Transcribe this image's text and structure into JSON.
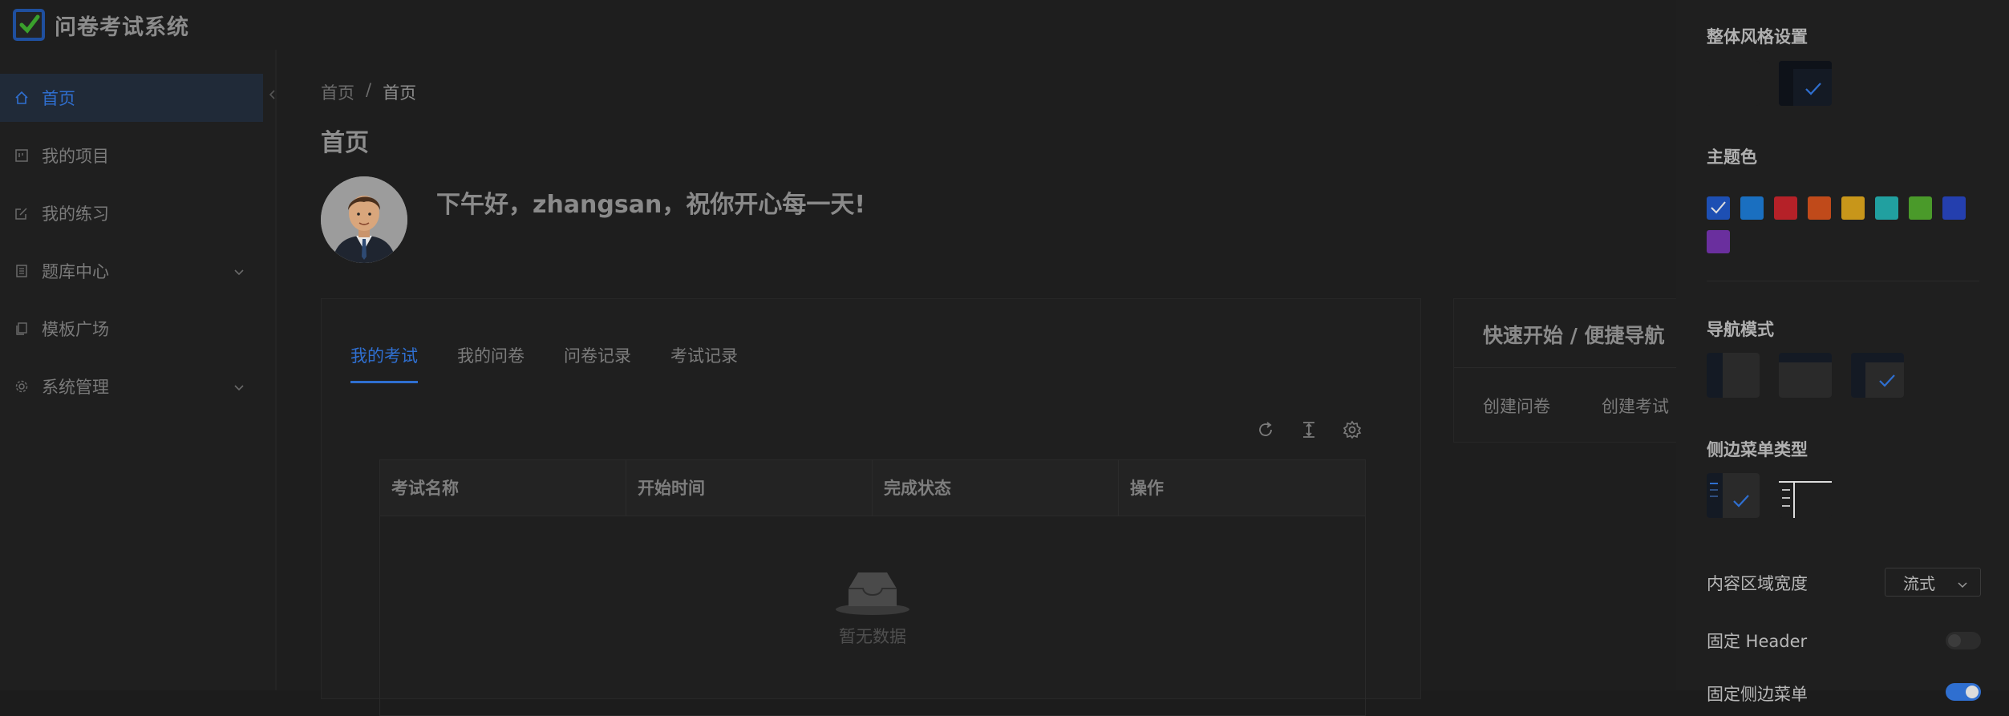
{
  "app": {
    "title": "问卷考试系统"
  },
  "sidebar": {
    "items": [
      {
        "label": "首页",
        "icon": "home-icon",
        "active": true
      },
      {
        "label": "我的项目",
        "icon": "project-icon"
      },
      {
        "label": "我的练习",
        "icon": "edit-icon"
      },
      {
        "label": "题库中心",
        "icon": "book-icon",
        "expandable": true
      },
      {
        "label": "模板广场",
        "icon": "template-icon"
      },
      {
        "label": "系统管理",
        "icon": "gear-icon",
        "expandable": true
      }
    ]
  },
  "breadcrumb": {
    "root": "首页",
    "separator": "/",
    "current": "首页"
  },
  "page": {
    "title": "首页",
    "greeting": "下午好，zhangsan，祝你开心每一天!"
  },
  "main_card": {
    "tabs": [
      "我的考试",
      "我的问卷",
      "问卷记录",
      "考试记录"
    ],
    "active_tab": "我的考试",
    "table": {
      "columns": [
        "考试名称",
        "开始时间",
        "完成状态",
        "操作"
      ],
      "rows": [],
      "empty_text": "暂无数据"
    }
  },
  "nav_card": {
    "title": "快速开始 / 便捷导航",
    "links": [
      "创建问卷",
      "创建考试"
    ]
  },
  "settings": {
    "style_title": "整体风格设置",
    "theme_color_title": "主题色",
    "theme_colors": [
      "#1d4fb3",
      "#1a6fc0",
      "#b52128",
      "#c04a1a",
      "#c8961a",
      "#21a0a0",
      "#4a9a2a",
      "#243fae",
      "#6a2f9e"
    ],
    "nav_mode_title": "导航模式",
    "side_menu_type_title": "侧边菜单类型",
    "content_width_label": "内容区域宽度",
    "content_width_value": "流式",
    "fixed_header_label": "固定 Header",
    "fixed_header_on": false,
    "fixed_side_menu_label": "固定侧边菜单",
    "fixed_side_menu_on": true,
    "accent_color": "#2f6fd0"
  }
}
